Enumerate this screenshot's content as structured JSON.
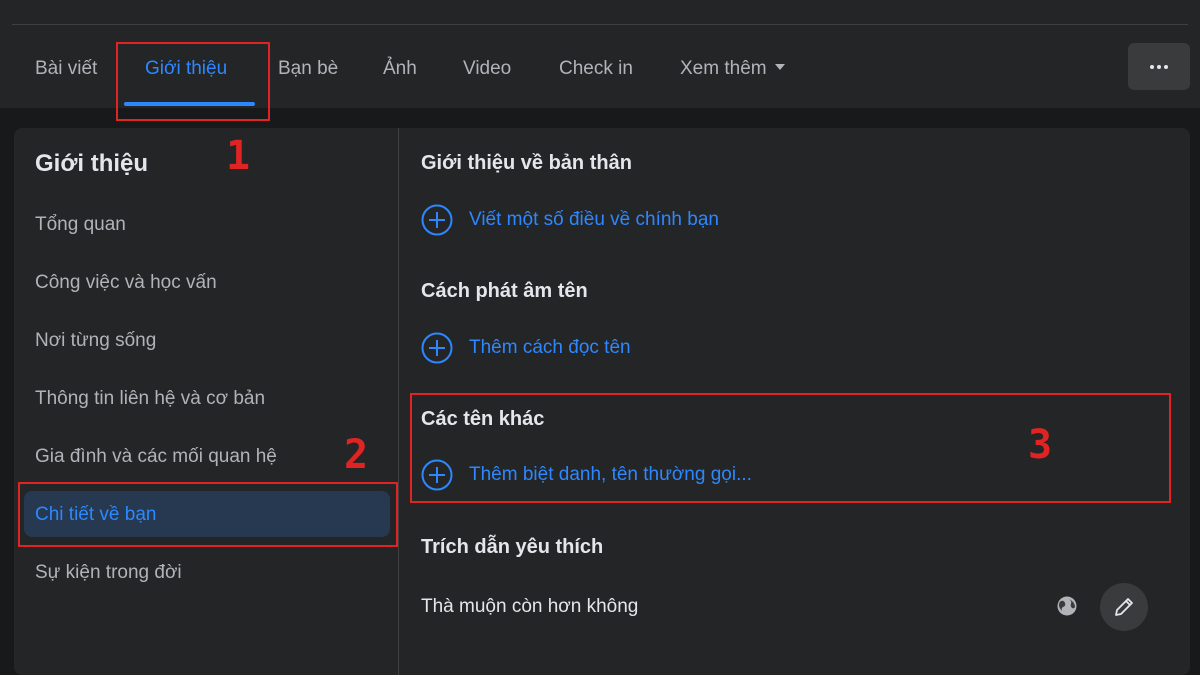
{
  "tabs": [
    {
      "label": "Bài viết"
    },
    {
      "label": "Giới thiệu"
    },
    {
      "label": "Bạn bè"
    },
    {
      "label": "Ảnh"
    },
    {
      "label": "Video"
    },
    {
      "label": "Check in"
    },
    {
      "label": "Xem thêm"
    }
  ],
  "active_tab": "Giới thiệu",
  "more_button_icon": "ellipsis-icon",
  "sidebar": {
    "title": "Giới thiệu",
    "items": [
      {
        "label": "Tổng quan"
      },
      {
        "label": "Công việc và học vấn"
      },
      {
        "label": "Nơi từng sống"
      },
      {
        "label": "Thông tin liên hệ và cơ bản"
      },
      {
        "label": "Gia đình và các mối quan hệ"
      },
      {
        "label": "Chi tiết về bạn"
      },
      {
        "label": "Sự kiện trong đời"
      }
    ],
    "active_item": "Chi tiết về bạn"
  },
  "main": {
    "sections": [
      {
        "title": "Giới thiệu về bản thân",
        "action": "Viết một số điều về chính bạn"
      },
      {
        "title": "Cách phát âm tên",
        "action": "Thêm cách đọc tên"
      },
      {
        "title": "Các tên khác",
        "action": "Thêm biệt danh, tên thường gọi..."
      },
      {
        "title": "Trích dẫn yêu thích",
        "value": "Thà muộn còn hơn không"
      }
    ]
  },
  "annotations": {
    "marker_1": "1",
    "marker_2": "2",
    "marker_3": "3"
  },
  "colors": {
    "accent": "#2d88ff",
    "annotation": "#e02424",
    "background": "#18191a",
    "surface": "#242526"
  }
}
